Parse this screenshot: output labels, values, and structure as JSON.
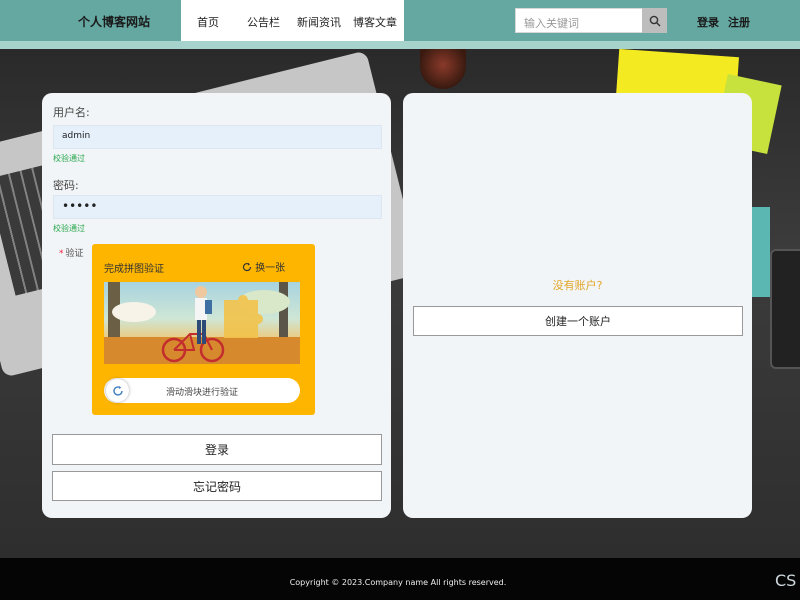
{
  "header": {
    "site_title": "个人博客网站",
    "nav": [
      "首页",
      "公告栏",
      "新闻资讯",
      "博客文章"
    ],
    "search_placeholder": "输入关键词",
    "login_link": "登录",
    "register_link": "注册"
  },
  "login_form": {
    "username_label": "用户名:",
    "username_value": "admin",
    "username_status": "校验通过",
    "password_label": "密码:",
    "password_value": "•••••",
    "password_status": "校验通过",
    "verify_label": "验证",
    "captcha": {
      "title": "完成拼图验证",
      "refresh_label": "换一张",
      "slider_text": "滑动滑块进行验证"
    },
    "login_button": "登录",
    "forgot_button": "忘记密码"
  },
  "register_panel": {
    "prompt": "没有账户?",
    "create_button": "创建一个账户"
  },
  "footer": {
    "copyright": "Copyright © 2023.Company name All rights reserved.",
    "corner_mark": "CS"
  },
  "colors": {
    "header_bg": "#64a8a1",
    "captcha_bg": "#fdb500",
    "valid_green": "#2aa74f",
    "prompt_orange": "#e2a527"
  }
}
